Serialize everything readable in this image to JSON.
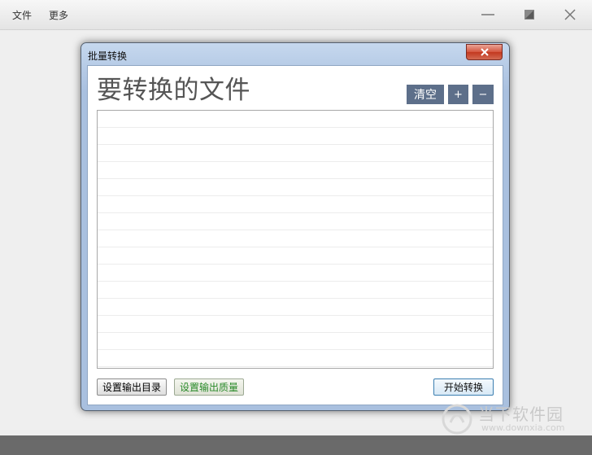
{
  "menu": {
    "items": [
      "文件",
      "更多"
    ]
  },
  "window_controls": [
    "minimize-icon",
    "restore-icon",
    "close-icon"
  ],
  "dialog": {
    "title": "批量转换",
    "heading": "要转换的文件",
    "buttons": {
      "clear": "清空",
      "add": "+",
      "remove": "−"
    },
    "file_list": {
      "rows": []
    },
    "bottom_buttons": {
      "set_output_dir": "设置输出目录",
      "set_output_quality": "设置输出质量",
      "start_convert": "开始转换"
    }
  },
  "watermark": {
    "text": "当下软件园",
    "url": "www.downxia.com"
  },
  "colors": {
    "accent_button": "#5d6f8a",
    "dialog_frame": "#a9c0df",
    "close_red": "#c3381f",
    "quality_text": "#2a8a2a"
  }
}
